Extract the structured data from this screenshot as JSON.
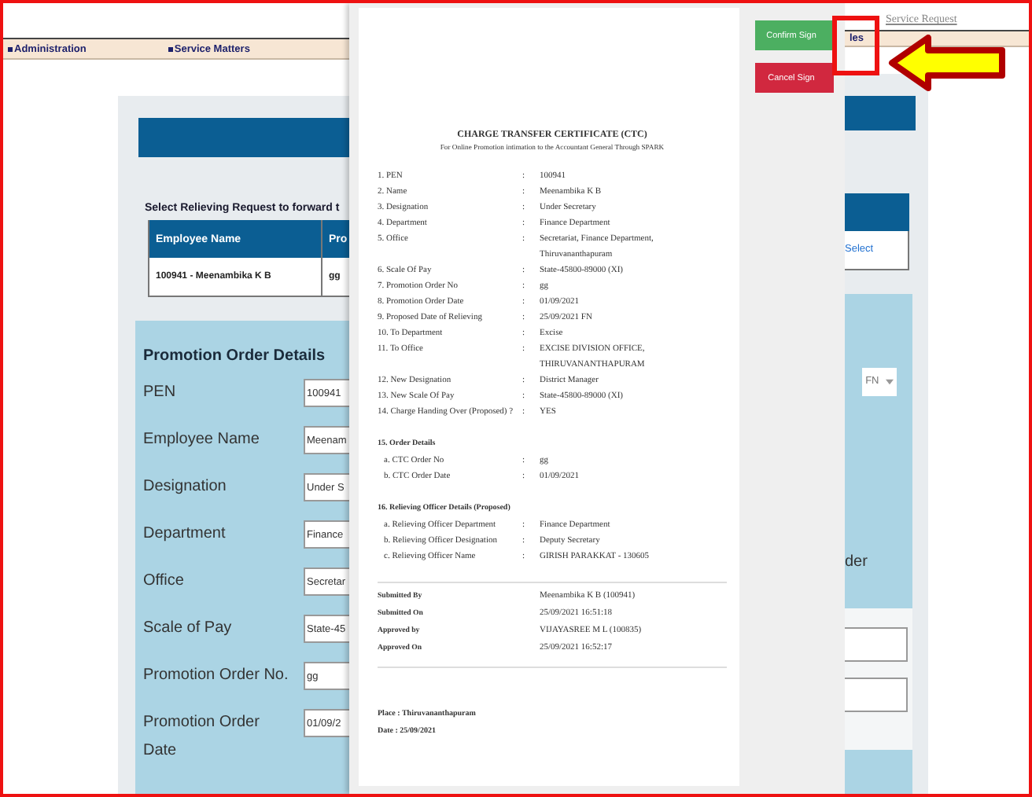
{
  "top_link": "Service Request",
  "menu": [
    {
      "label": "Administration",
      "kind": "item"
    },
    {
      "label": "Service Matters",
      "kind": "item"
    }
  ],
  "menu_fragment": "les",
  "request_table": {
    "caption": "Select Relieving Request to forward t",
    "columns": [
      "Employee Name",
      "Pro"
    ],
    "row": [
      "100941 - Meenambika K B",
      "gg"
    ],
    "action": "Select"
  },
  "promotion_form": {
    "title": "Promotion Order Details",
    "fields": [
      {
        "label": "PEN",
        "value": "100941"
      },
      {
        "label": "Employee Name",
        "value": "Meenam"
      },
      {
        "label": "Designation",
        "value": "Under S"
      },
      {
        "label": "Department",
        "value": "Finance"
      },
      {
        "label": "Office",
        "value": "Secretar"
      },
      {
        "label": "Scale of Pay",
        "value": "State-45"
      },
      {
        "label": "Promotion Order No.",
        "value": "gg"
      },
      {
        "label": "Promotion Order Date",
        "value": "01/09/2"
      }
    ],
    "session": "FN",
    "fragment": "der"
  },
  "certificate": {
    "title": "CHARGE TRANSFER CERTIFICATE (CTC)",
    "subtitle": "For Online Promotion intimation to the Accountant General Through SPARK",
    "separator": ":",
    "items": [
      {
        "label": "1. PEN",
        "value": "100941"
      },
      {
        "label": "2. Name",
        "value": "Meenambika K B"
      },
      {
        "label": "3. Designation",
        "value": "Under Secretary"
      },
      {
        "label": "4. Department",
        "value": "Finance Department"
      },
      {
        "label": "5. Office",
        "value": "Secretariat, Finance Department, Thiruvananthapuram"
      },
      {
        "label": "6. Scale Of Pay",
        "value": "State-45800-89000 (XI)"
      },
      {
        "label": "7. Promotion Order No",
        "value": "gg"
      },
      {
        "label": "8. Promotion Order Date",
        "value": "01/09/2021"
      },
      {
        "label": "9. Proposed Date of Relieving",
        "value": "25/09/2021 FN"
      },
      {
        "label": "10. To Department",
        "value": "Excise"
      },
      {
        "label": "11. To Office",
        "value": "EXCISE DIVISION OFFICE, THIRUVANANTHAPURAM"
      },
      {
        "label": "12. New Designation",
        "value": "District Manager"
      },
      {
        "label": "13. New Scale Of Pay",
        "value": "State-45800-89000 (XI)"
      },
      {
        "label": "14. Charge Handing Over (Proposed) ?",
        "value": "YES"
      }
    ],
    "sections": [
      {
        "heading": "15. Order Details",
        "items": [
          {
            "label": "a. CTC Order No",
            "value": "gg"
          },
          {
            "label": "b. CTC Order Date",
            "value": "01/09/2021"
          }
        ]
      },
      {
        "heading": "16. Relieving Officer Details (Proposed)",
        "items": [
          {
            "label": "a. Relieving Officer Department",
            "value": "Finance Department"
          },
          {
            "label": "b. Relieving Officer Designation",
            "value": "Deputy Secretary"
          },
          {
            "label": "c. Relieving Officer Name",
            "value": "GIRISH PARAKKAT - 130605"
          }
        ]
      }
    ],
    "approval": [
      {
        "label": "Submitted By",
        "value": "Meenambika K B (100941)"
      },
      {
        "label": "Submitted On",
        "value": "25/09/2021 16:51:18"
      },
      {
        "label": "Approved by",
        "value": "VIJAYASREE M L (100835)"
      },
      {
        "label": "Approved On",
        "value": "25/09/2021 16:52:17"
      }
    ],
    "place": "Place : Thiruvananthapuram",
    "date": "Date : 25/09/2021"
  },
  "modal_buttons": [
    {
      "label": "Confirm Sign",
      "kind": "confirm"
    },
    {
      "label": "Cancel Sign",
      "kind": "cancel"
    }
  ]
}
